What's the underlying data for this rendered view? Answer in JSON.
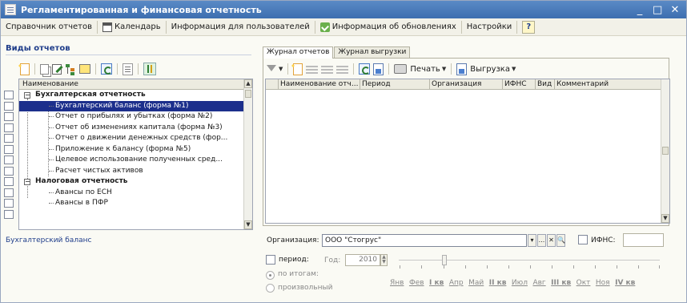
{
  "window": {
    "title": "Регламентированная и финансовая отчетность",
    "controls": {
      "minimize": "_",
      "maximize": "□",
      "close": "✕"
    }
  },
  "menubar": {
    "items": [
      {
        "label": "Справочник отчетов"
      },
      {
        "label": "Календарь",
        "icon": "calendar-icon"
      },
      {
        "label": "Информация для пользователей"
      },
      {
        "label": "Информация об обновлениях",
        "icon": "update-icon"
      },
      {
        "label": "Настройки"
      }
    ],
    "help": "?"
  },
  "left": {
    "title": "Виды отчетов",
    "column_header": "Наименование",
    "groups": [
      {
        "label": "Бухгалтерская отчетность",
        "expander": "−",
        "items": [
          "Бухгалтерский баланс (форма №1)",
          "Отчет о прибылях и убытках (форма №2)",
          "Отчет об изменениях капитала (форма №3)",
          "Отчет о движении денежных средств (фор...",
          "Приложение к балансу (форма №5)",
          "Целевое использование полученных сред...",
          "Расчет чистых активов"
        ]
      },
      {
        "label": "Налоговая отчетность",
        "expander": "−",
        "items": [
          "Авансы по ЕСН",
          "Авансы в ПФР"
        ]
      }
    ],
    "selected_item": "Бухгалтерский баланс (форма №1)",
    "bottom_label": "Бухгалтерский баланс"
  },
  "right": {
    "tabs": [
      {
        "label": "Журнал отчетов",
        "active": true
      },
      {
        "label": "Журнал выгрузки",
        "active": false
      }
    ],
    "toolbar": {
      "print_label": "Печать",
      "export_label": "Выгрузка"
    },
    "journal_columns": [
      "Наименование отч...",
      "Период",
      "Организация",
      "ИФНС",
      "Вид",
      "Комментарий"
    ]
  },
  "filters": {
    "org_label": "Организация:",
    "org_value": "ООО \"Стогрус\"",
    "org_buttons": [
      "▾",
      "...",
      "✕",
      "🔍"
    ],
    "ifns_label": "ИФНС:",
    "ifns_checked": false,
    "period_label": "период:",
    "period_checked": false,
    "year_label": "Год:",
    "year_value": "2010",
    "radio_totals": "по итогам:",
    "radio_custom": "произвольный",
    "months": [
      "Янв",
      "Фев",
      "I кв",
      "Апр",
      "Май",
      "II кв",
      "Июл",
      "Авг",
      "III кв",
      "Окт",
      "Ноя",
      "IV кв"
    ]
  },
  "colors": {
    "titlebar": "#3d6eb0",
    "selection": "#1c2f8c",
    "accent_text": "#1f3d8a"
  }
}
